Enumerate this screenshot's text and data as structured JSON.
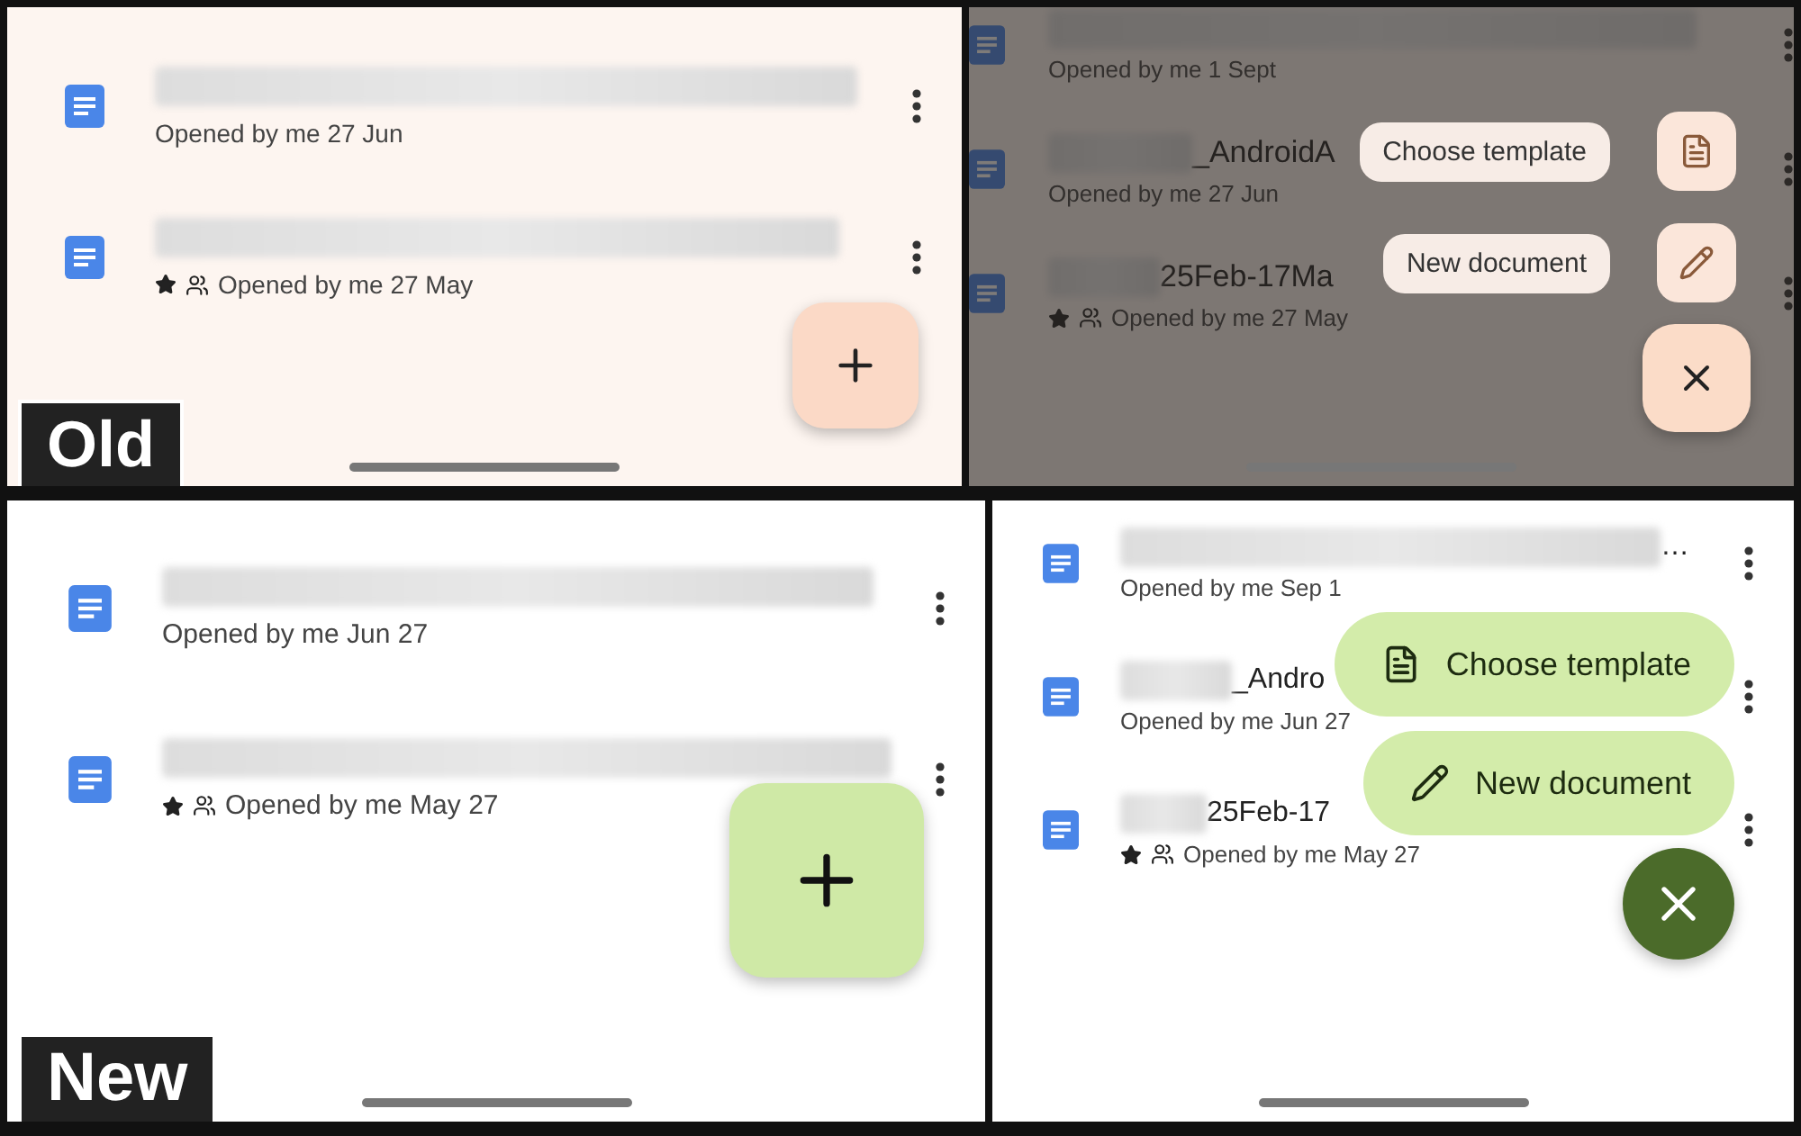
{
  "panels": [
    {
      "badge": "Old",
      "fab_open": false,
      "files": [
        {
          "subtitle": "Opened by me 27 Jun",
          "starred": false,
          "shared": false
        },
        {
          "subtitle": "Opened by me 27 May",
          "starred": true,
          "shared": true
        }
      ]
    },
    {
      "fab_open": true,
      "files": [
        {
          "subtitle": "Opened by me 1 Sept",
          "starred": false,
          "shared": false
        },
        {
          "title": "_AndroidA",
          "subtitle": "Opened by me 27 Jun",
          "starred": false,
          "shared": false
        },
        {
          "title": "25Feb-17Ma",
          "subtitle": "Opened by me 27 May",
          "starred": true,
          "shared": true
        }
      ],
      "menu": [
        {
          "kind": "template",
          "label": "Choose template"
        },
        {
          "kind": "new",
          "label": "New document"
        }
      ]
    },
    {
      "badge": "New",
      "fab_open": false,
      "files": [
        {
          "subtitle": "Opened by me Jun 27",
          "starred": false,
          "shared": false
        },
        {
          "subtitle": "Opened by me May 27",
          "starred": true,
          "shared": true
        }
      ]
    },
    {
      "fab_open": true,
      "files": [
        {
          "title": "…",
          "subtitle": "Opened by me Sep 1",
          "starred": false,
          "shared": false
        },
        {
          "title": "_Andro",
          "subtitle": "Opened by me Jun 27",
          "starred": false,
          "shared": false
        },
        {
          "title": "25Feb-17",
          "subtitle": "Opened by me May 27",
          "starred": true,
          "shared": true
        }
      ],
      "menu": [
        {
          "kind": "template",
          "label": "Choose template"
        },
        {
          "kind": "new",
          "label": "New document"
        }
      ]
    }
  ]
}
